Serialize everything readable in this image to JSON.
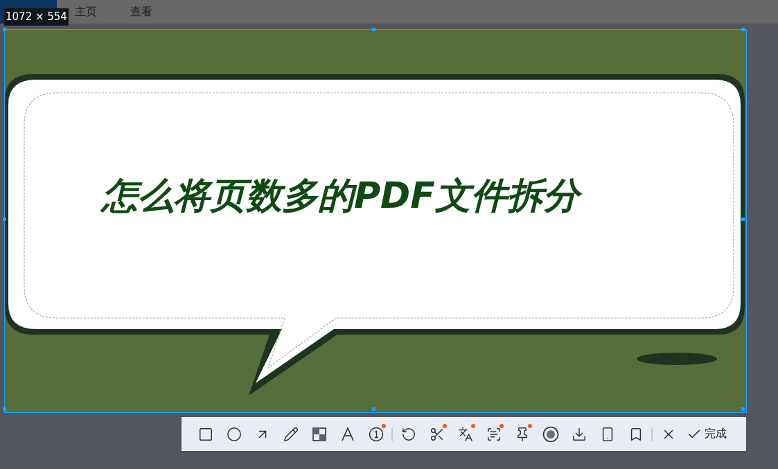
{
  "menu": [
    {
      "selected": true
    },
    {
      "label": "主页",
      "selected": false
    },
    {
      "label": "查看",
      "selected": false
    }
  ],
  "selection": {
    "size_label": "1072 × 554",
    "image_title": "怎么将页数多的PDF文件拆分"
  },
  "toolbar": {
    "groups": [
      {
        "tools": [
          {
            "new_dot": false
          },
          {
            "new_dot": false
          },
          {
            "new_dot": false
          },
          {
            "new_dot": false
          },
          {
            "new_dot": false
          },
          {
            "new_dot": false
          },
          {
            "new_dot": true
          }
        ]
      },
      {
        "tools": [
          {
            "new_dot": false
          },
          {
            "new_dot": true
          },
          {
            "new_dot": true
          },
          {
            "new_dot": true
          },
          {
            "new_dot": true
          },
          {
            "new_dot": false
          },
          {
            "new_dot": false
          },
          {
            "new_dot": false
          },
          {
            "new_dot": false
          }
        ]
      },
      {
        "tools": [
          {
            "new_dot": false
          }
        ]
      }
    ],
    "done_button": {
      "label": "完成"
    }
  }
}
